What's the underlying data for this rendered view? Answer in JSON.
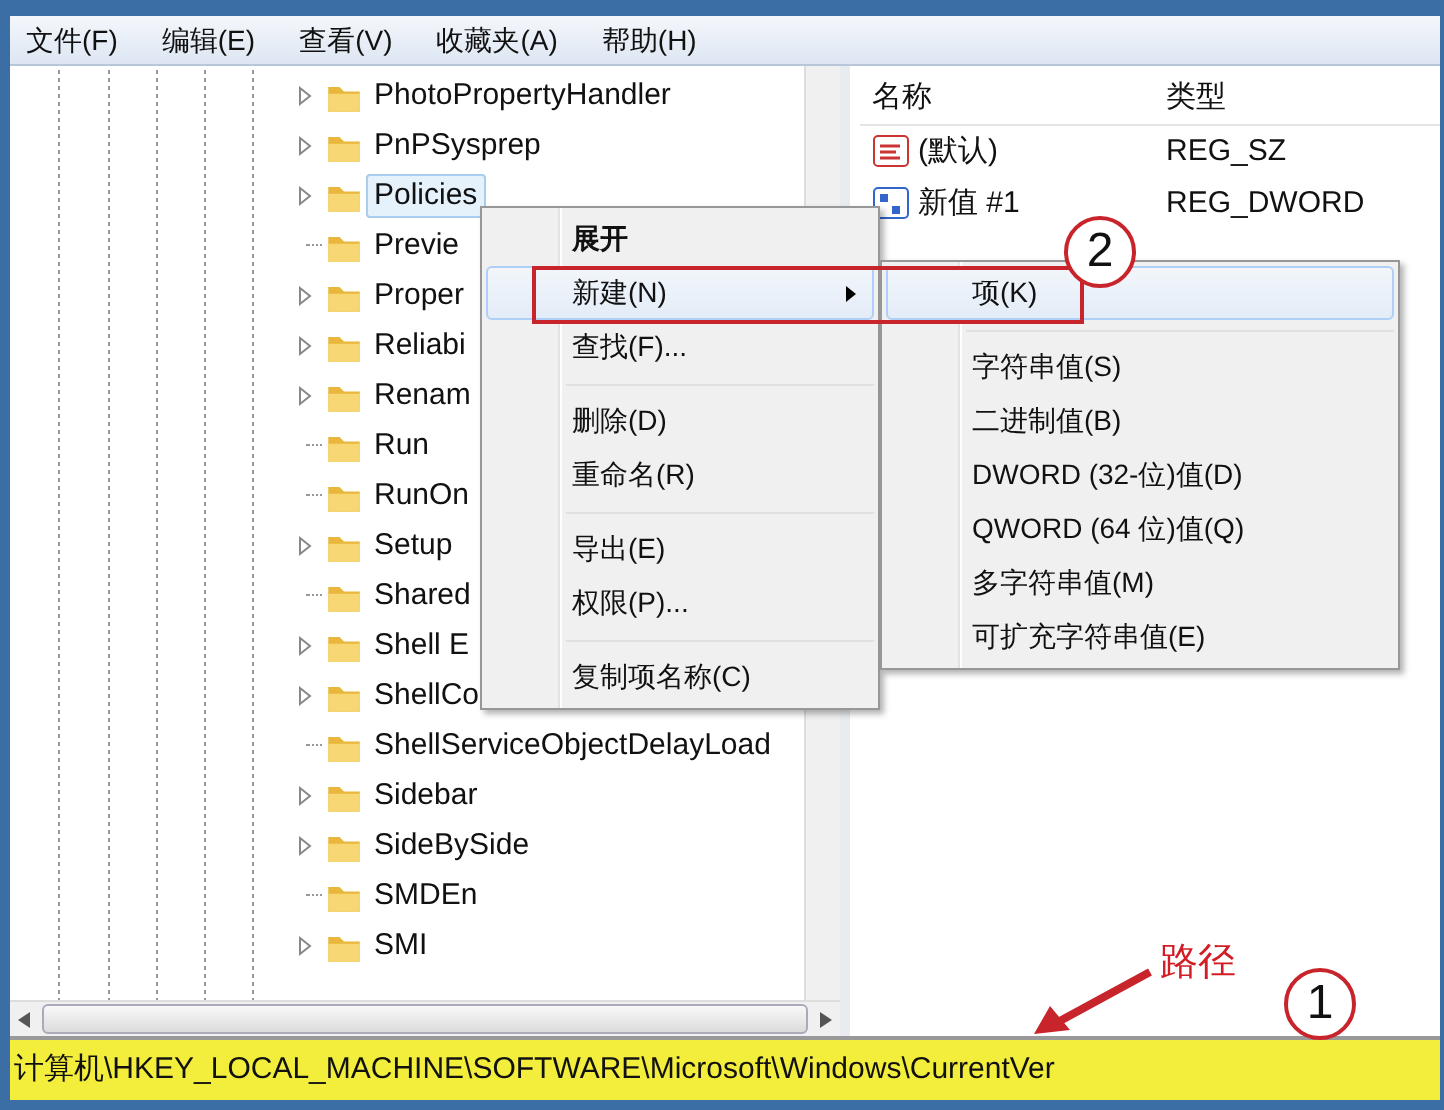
{
  "menu_bar": [
    "文件(F)",
    "编辑(E)",
    "查看(V)",
    "收藏夹(A)",
    "帮助(H)"
  ],
  "tree": {
    "items": [
      {
        "label": "PhotoPropertyHandler",
        "expandable": true,
        "selected": false
      },
      {
        "label": "PnPSysprep",
        "expandable": true,
        "selected": false
      },
      {
        "label": "Policies",
        "expandable": true,
        "selected": true
      },
      {
        "label": "Previe",
        "expandable": false,
        "selected": false
      },
      {
        "label": "Proper",
        "expandable": true,
        "selected": false
      },
      {
        "label": "Reliabi",
        "expandable": true,
        "selected": false
      },
      {
        "label": "Renam",
        "expandable": true,
        "selected": false
      },
      {
        "label": "Run",
        "expandable": false,
        "selected": false
      },
      {
        "label": "RunOn",
        "expandable": false,
        "selected": false
      },
      {
        "label": "Setup",
        "expandable": true,
        "selected": false
      },
      {
        "label": "Shared",
        "expandable": false,
        "selected": false
      },
      {
        "label": "Shell E",
        "expandable": true,
        "selected": false
      },
      {
        "label": "ShellCo",
        "expandable": true,
        "selected": false
      },
      {
        "label": "ShellServiceObjectDelayLoad",
        "expandable": false,
        "selected": false
      },
      {
        "label": "Sidebar",
        "expandable": true,
        "selected": false
      },
      {
        "label": "SideBySide",
        "expandable": true,
        "selected": false
      },
      {
        "label": "SMDEn",
        "expandable": false,
        "selected": false
      },
      {
        "label": "SMI",
        "expandable": true,
        "selected": false
      }
    ]
  },
  "values": {
    "columns": [
      "名称",
      "类型"
    ],
    "rows": [
      {
        "kind": "string",
        "name": "(默认)",
        "type": "REG_SZ"
      },
      {
        "kind": "number",
        "name": "新值 #1",
        "type": "REG_DWORD"
      }
    ]
  },
  "context_menu": {
    "items": [
      {
        "kind": "item",
        "label": "展开",
        "default": true,
        "selected": false,
        "has_submenu": false
      },
      {
        "kind": "item",
        "label": "新建(N)",
        "default": false,
        "selected": true,
        "has_submenu": true
      },
      {
        "kind": "item",
        "label": "查找(F)...",
        "default": false,
        "selected": false,
        "has_submenu": false
      },
      {
        "kind": "separator"
      },
      {
        "kind": "item",
        "label": "删除(D)",
        "default": false,
        "selected": false,
        "has_submenu": false
      },
      {
        "kind": "item",
        "label": "重命名(R)",
        "default": false,
        "selected": false,
        "has_submenu": false
      },
      {
        "kind": "separator"
      },
      {
        "kind": "item",
        "label": "导出(E)",
        "default": false,
        "selected": false,
        "has_submenu": false
      },
      {
        "kind": "item",
        "label": "权限(P)...",
        "default": false,
        "selected": false,
        "has_submenu": false
      },
      {
        "kind": "separator"
      },
      {
        "kind": "item",
        "label": "复制项名称(C)",
        "default": false,
        "selected": false,
        "has_submenu": false
      }
    ]
  },
  "submenu": {
    "items": [
      {
        "kind": "item",
        "label": "项(K)",
        "selected": true
      },
      {
        "kind": "separator"
      },
      {
        "kind": "item",
        "label": "字符串值(S)",
        "selected": false
      },
      {
        "kind": "item",
        "label": "二进制值(B)",
        "selected": false
      },
      {
        "kind": "item",
        "label": "DWORD (32-位)值(D)",
        "selected": false
      },
      {
        "kind": "item",
        "label": "QWORD (64 位)值(Q)",
        "selected": false
      },
      {
        "kind": "item",
        "label": "多字符串值(M)",
        "selected": false
      },
      {
        "kind": "item",
        "label": "可扩充字符串值(E)",
        "selected": false
      }
    ]
  },
  "status_bar": "计算机\\HKEY_LOCAL_MACHINE\\SOFTWARE\\Microsoft\\Windows\\CurrentVer",
  "annotations": [
    {
      "kind": "frame"
    },
    {
      "kind": "step",
      "text": "2"
    },
    {
      "kind": "label",
      "text": "路径"
    },
    {
      "kind": "arrow"
    },
    {
      "kind": "step",
      "text": "1"
    }
  ]
}
